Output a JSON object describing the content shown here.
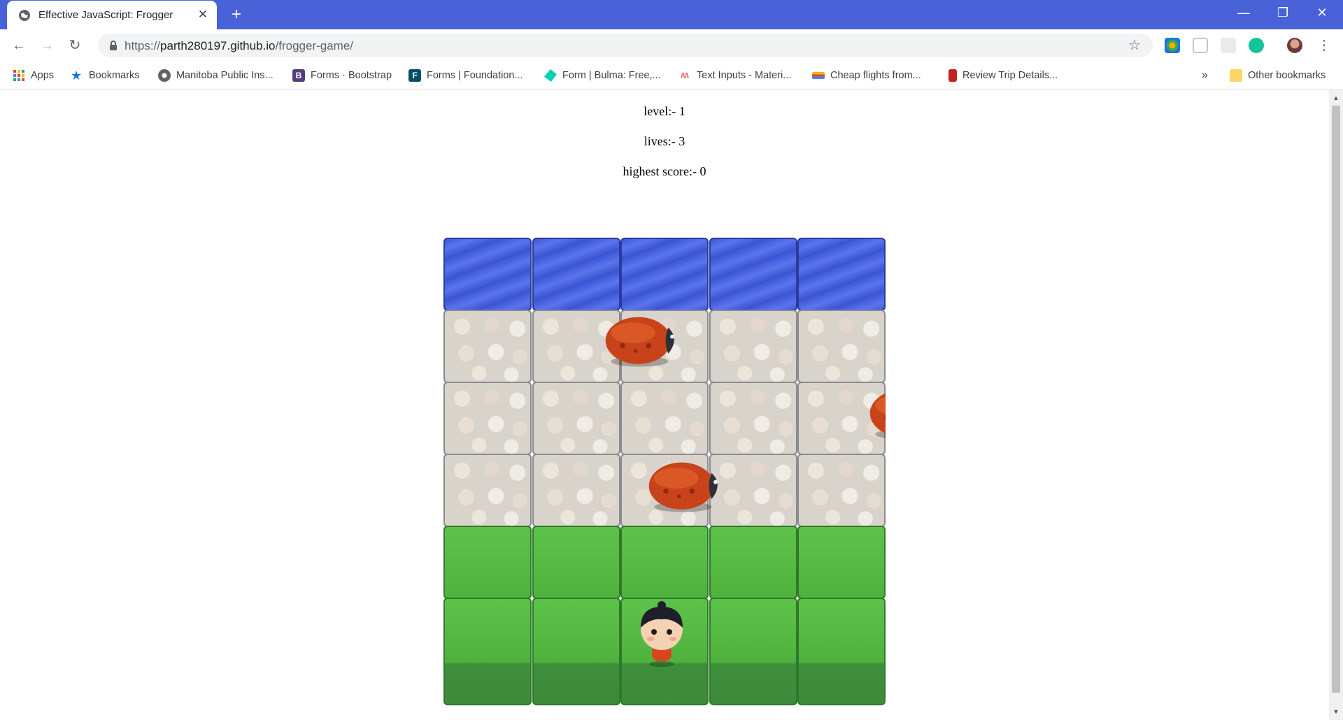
{
  "browser": {
    "tab_title": "Effective JavaScript: Frogger",
    "new_tab_symbol": "+",
    "url_prefix": "https://",
    "url_host": "parth280197.github.io",
    "url_path": "/frogger-game/"
  },
  "bookmarks": [
    {
      "label": "Apps",
      "icon": "apps-grid-icon",
      "color": "#ea4335"
    },
    {
      "label": "Bookmarks",
      "icon": "star-icon",
      "color": "#1a73e8"
    },
    {
      "label": "Manitoba Public Ins...",
      "icon": "globe-icon",
      "color": "#5f6368"
    },
    {
      "label": "Forms · Bootstrap",
      "icon": "bootstrap-icon",
      "color": "#563d7c"
    },
    {
      "label": "Forms | Foundation...",
      "icon": "foundation-icon",
      "color": "#074e68"
    },
    {
      "label": "Form | Bulma: Free,...",
      "icon": "bulma-icon",
      "color": "#00d1b2"
    },
    {
      "label": "Text Inputs - Materi...",
      "icon": "materialize-icon",
      "color": "#ee6e73"
    },
    {
      "label": "Cheap flights from...",
      "icon": "flights-icon",
      "color": "#f4b400"
    },
    {
      "label": "Review Trip Details...",
      "icon": "bag-icon",
      "color": "#c5221f"
    }
  ],
  "bookmarks_overflow": "»",
  "other_bookmarks": "Other bookmarks",
  "game": {
    "level_label": "level:- 1",
    "lives_label": "lives:- 3",
    "score_label": "highest score:- 0",
    "rows": [
      "water",
      "stone",
      "stone",
      "stone",
      "grass",
      "grass"
    ],
    "columns": 5
  },
  "colors": {
    "titlebar": "#4a62d8",
    "water": "#4a66e0",
    "grass": "#5dc24a",
    "bug": "#c8431a"
  }
}
